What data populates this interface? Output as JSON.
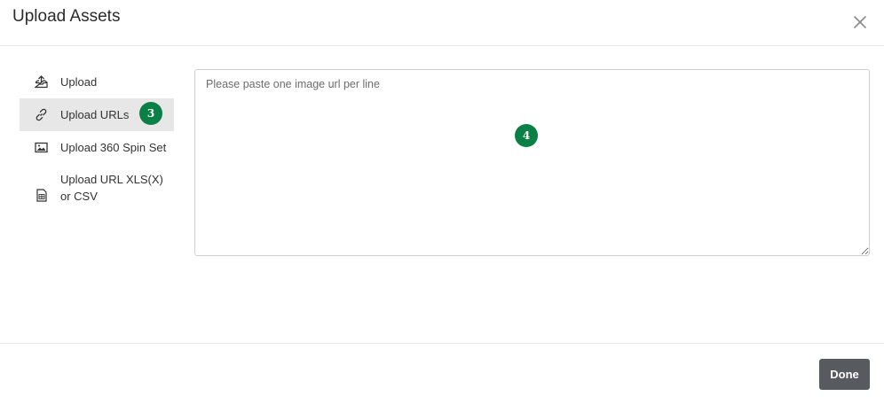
{
  "modal": {
    "title": "Upload Assets"
  },
  "sidebar": {
    "items": [
      {
        "label": "Upload",
        "icon": "upload-tray-icon"
      },
      {
        "label": "Upload URLs",
        "icon": "link-icon",
        "active": true
      },
      {
        "label": "Upload 360 Spin Set",
        "icon": "image-icon"
      },
      {
        "label": "Upload URL XLS(X) or CSV",
        "icon": "spreadsheet-file-icon"
      }
    ]
  },
  "annotations": {
    "badge_sidebar": "3",
    "badge_textarea": "4"
  },
  "main": {
    "textarea_placeholder": "Please paste one image url per line",
    "textarea_value": ""
  },
  "footer": {
    "done_label": "Done"
  },
  "colors": {
    "badge": "#0a8046",
    "done_button": "#575b60",
    "active_item_bg": "#e7e7e7"
  }
}
